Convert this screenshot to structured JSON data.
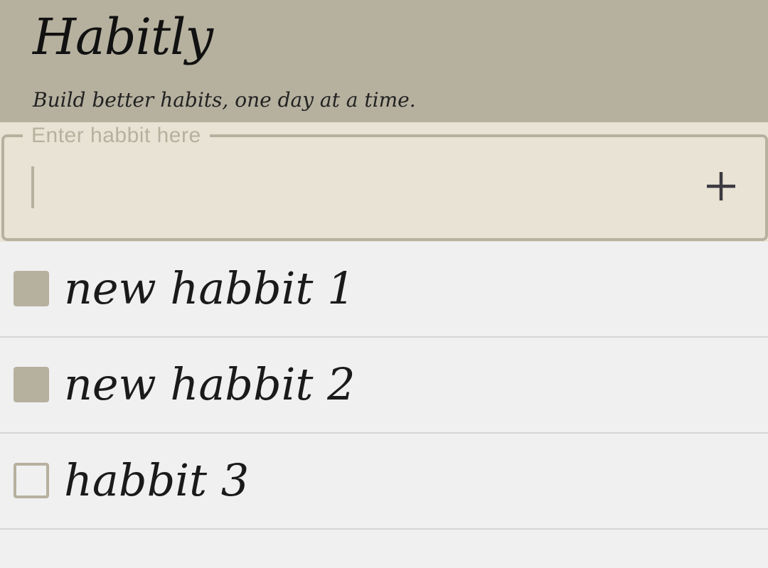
{
  "header": {
    "title": "Habitly",
    "tagline": "Build better habits, one day at a time."
  },
  "input": {
    "legend": "Enter habbit here",
    "value": "",
    "add_icon": "plus-icon"
  },
  "habits": [
    {
      "label": "new habbit 1",
      "checked": true
    },
    {
      "label": "new habbit 2",
      "checked": true
    },
    {
      "label": "habbit 3",
      "checked": false
    }
  ],
  "colors": {
    "header_bg": "#b6b19f",
    "input_bg": "#e9e3d5",
    "list_bg": "#f0f0f0",
    "accent": "#b6b19f"
  }
}
